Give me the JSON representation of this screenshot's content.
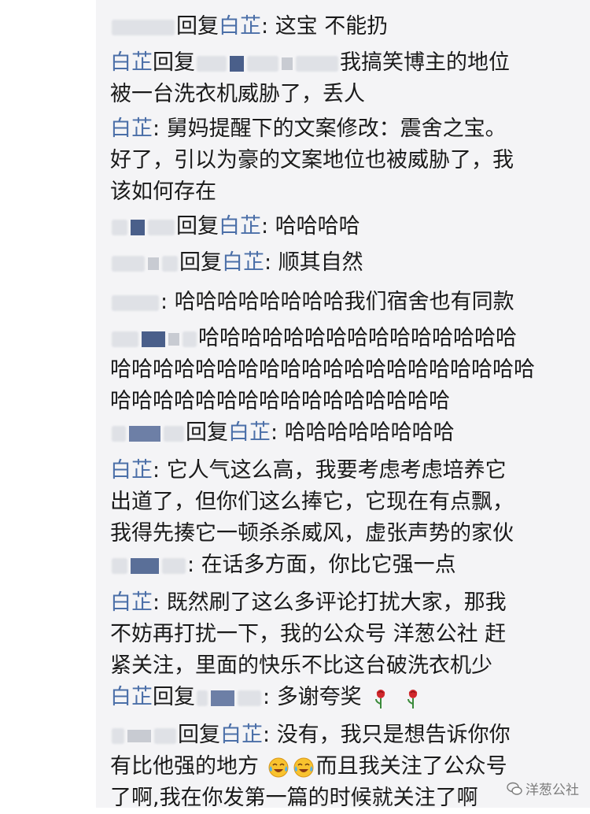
{
  "comments": [
    {
      "user": "白芷",
      "reply_word": "回复",
      "colon": ": ",
      "text": "这宝 不能扔"
    },
    {
      "user": "白芷",
      "reply_word": "回复",
      "text1": "我搞笑博主的地位",
      "text2": "被一台洗衣机威胁了，丢人"
    },
    {
      "user": "白芷",
      "colon": ": ",
      "text1": "舅妈提醒下的文案修改：震舍之宝。",
      "text2": "好了，引以为豪的文案地位也被威胁了，我",
      "text3": "该如何存在"
    },
    {
      "user": "白芷",
      "reply_word": "回复",
      "colon": ": ",
      "text": "哈哈哈哈"
    },
    {
      "user": "白芷",
      "reply_word": "回复",
      "colon": ": ",
      "text": "顺其自然"
    },
    {
      "colon": ": ",
      "text": "哈哈哈哈哈哈哈哈我们宿舍也有同款"
    },
    {
      "text1": "哈哈哈哈哈哈哈哈哈哈哈哈哈哈哈",
      "text2": "哈哈哈哈哈哈哈哈哈哈哈哈哈哈哈哈哈哈哈哈",
      "text3": "哈哈哈哈哈哈哈哈哈哈哈哈哈哈哈哈"
    },
    {
      "user": "白芷",
      "reply_word": "回复",
      "colon": ": ",
      "text": "哈哈哈哈哈哈哈哈"
    },
    {
      "user": "白芷",
      "colon": ": ",
      "text1": "它人气这么高，我要考虑考虑培养它",
      "text2": "出道了，但你们这么捧它，它现在有点飘，",
      "text3": "我得先揍它一顿杀杀威风，虚张声势的家伙"
    },
    {
      "colon": ": ",
      "text": "在话多方面，你比它强一点"
    },
    {
      "user": "白芷",
      "colon": ": ",
      "text1": "既然刷了这么多评论打扰大家，那我",
      "text2": "不妨再打扰一下，我的公众号 洋葱公社 赶",
      "text3": "紧关注，里面的快乐不比这台破洗衣机少"
    },
    {
      "user": "白芷",
      "reply_word": "回复",
      "colon": ": ",
      "text": "多谢夸奖"
    },
    {
      "user": "白芷",
      "reply_word": "回复",
      "colon": ": ",
      "text1": "没有，我只是想告诉你你",
      "text2a": "有比他强的地方",
      "text2b": "而且我关注了公众号",
      "text3": "了啊,我在你发第一篇的时候就关注了啊"
    }
  ],
  "watermark": "洋葱公社"
}
